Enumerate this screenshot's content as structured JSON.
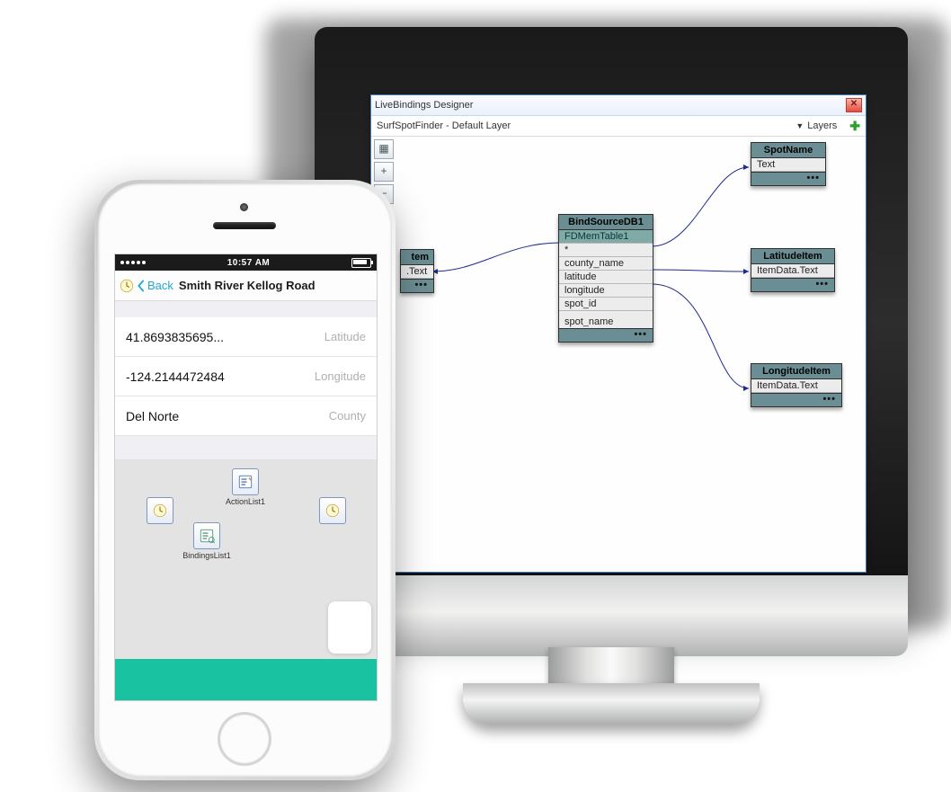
{
  "designer": {
    "title": "LiveBindings Designer",
    "layer_label": "SurfSpotFinder  - Default Layer",
    "layers_btn": "Layers",
    "tools": {
      "grid": "▦",
      "zoom_in": "+",
      "zoom_out": "−"
    },
    "nodes": {
      "partial": {
        "title": "tem",
        "row": ".Text"
      },
      "bindsource": {
        "title": "BindSourceDB1",
        "rows": [
          "FDMemTable1",
          "*",
          "county_name",
          "latitude",
          "longitude",
          "spot_id",
          "spot_name"
        ]
      },
      "spotname": {
        "title": "SpotName",
        "row": "Text"
      },
      "latitude": {
        "title": "LatitudeItem",
        "row": "ItemData.Text"
      },
      "longitude": {
        "title": "LongitudeItem",
        "row": "ItemData.Text"
      }
    }
  },
  "phone": {
    "status": {
      "time": "10:57 AM"
    },
    "nav": {
      "back": "Back",
      "title": "Smith River Kellog Road"
    },
    "rows": [
      {
        "value": "41.8693835695...",
        "label": "Latitude"
      },
      {
        "value": "-124.2144472484",
        "label": "Longitude"
      },
      {
        "value": "Del Norte",
        "label": "County"
      }
    ],
    "components": {
      "actionlist": "ActionList1",
      "bindingslist": "BindingsList1"
    }
  }
}
